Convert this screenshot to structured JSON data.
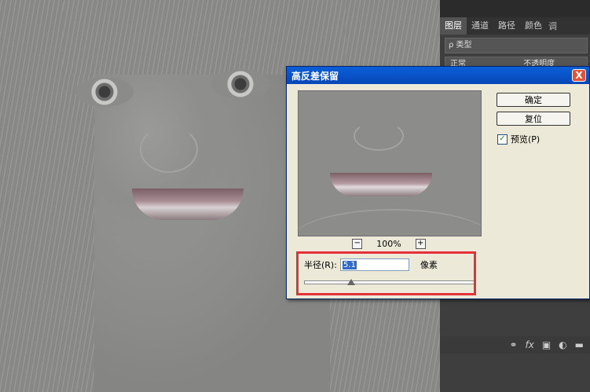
{
  "app": {
    "panel": {
      "tabs": [
        "图层",
        "通道",
        "路径",
        "颜色"
      ],
      "more_label": "调",
      "filter_label": "ρ 类型",
      "blend_label": "正常",
      "opacity_label": "不透明度",
      "footer_fx_label": "fx"
    },
    "dialog": {
      "title": "高反差保留",
      "close_label": "X",
      "ok_label": "确定",
      "reset_label": "复位",
      "preview_label": "预览(P)",
      "preview_checked": true,
      "zoom": {
        "minus_label": "−",
        "plus_label": "+",
        "percent": "100%"
      },
      "radius": {
        "label": "半径(R):",
        "value": "5.1",
        "unit": "像素",
        "slider_position_fraction": 0.28
      }
    }
  }
}
